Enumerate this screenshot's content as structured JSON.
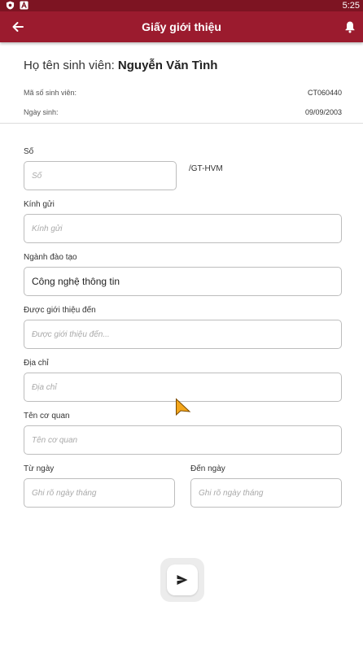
{
  "status_bar": {
    "time": "5:25",
    "icons": [
      "shield-icon",
      "a-icon"
    ]
  },
  "app_bar": {
    "title": "Giấy giới thiệu",
    "back_icon": "arrow-left-icon",
    "bell_icon": "bell-icon",
    "color": "#9b1b2e"
  },
  "student": {
    "name_label": "Họ tên sinh viên: ",
    "name": "Nguyễn Văn Tình",
    "id_label": "Mã số sinh viên:",
    "id_value": "CT060440",
    "dob_label": "Ngày sinh:",
    "dob_value": "09/09/2003"
  },
  "form": {
    "so": {
      "label": "Số",
      "placeholder": "Số",
      "suffix": "/GT-HVM"
    },
    "kinh_gui": {
      "label": "Kính gửi",
      "placeholder": "Kính gửi"
    },
    "nganh": {
      "label": "Ngành đào tạo",
      "value": "Công nghệ thông tin"
    },
    "gioi_thieu_den": {
      "label": "Được giới thiệu đến",
      "placeholder": "Được giới thiệu đến..."
    },
    "dia_chi": {
      "label": "Địa chỉ",
      "placeholder": "Địa chỉ"
    },
    "co_quan": {
      "label": "Tên cơ quan",
      "placeholder": "Tên cơ quan"
    },
    "tu_ngay": {
      "label": "Từ ngày",
      "placeholder": "Ghi rõ ngày tháng"
    },
    "den_ngay": {
      "label": "Đến ngày",
      "placeholder": "Ghi rõ ngày tháng"
    }
  },
  "send_button": {
    "icon": "send-icon"
  }
}
